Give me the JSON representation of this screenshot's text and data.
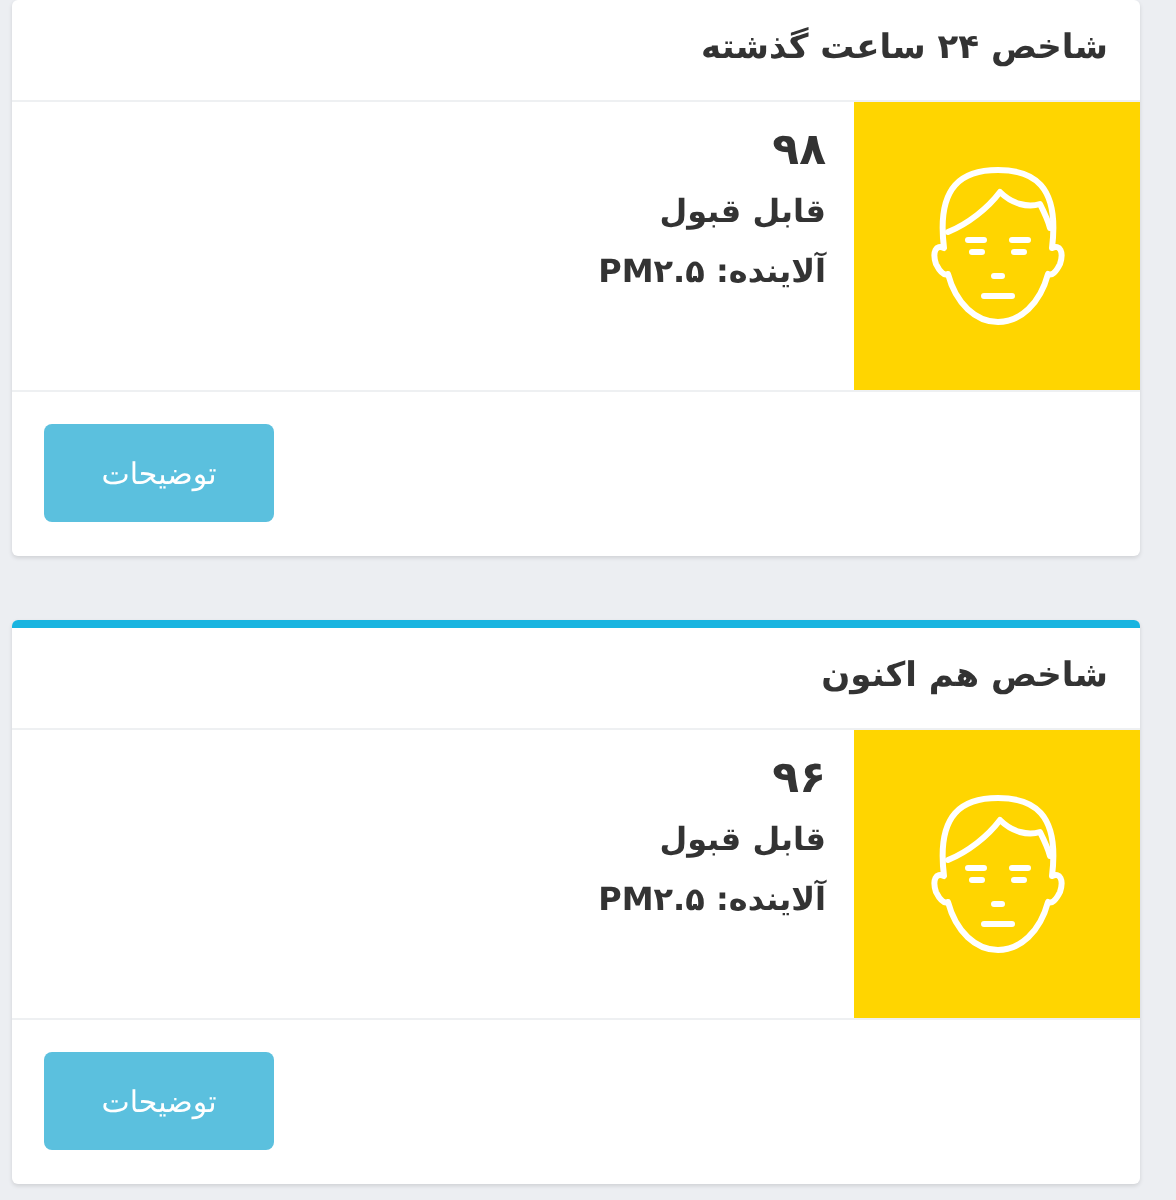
{
  "cards": [
    {
      "title": "شاخص ۲۴ ساعت گذشته",
      "accent_bar": false,
      "value": "۹۸",
      "status": "قابل قبول",
      "pollutant": "آلاینده: PM۲.۵",
      "button": "توضیحات"
    },
    {
      "title": "شاخص هم اکنون",
      "accent_bar": true,
      "value": "۹۶",
      "status": "قابل قبول",
      "pollutant": "آلاینده: PM۲.۵",
      "button": "توضیحات"
    }
  ]
}
